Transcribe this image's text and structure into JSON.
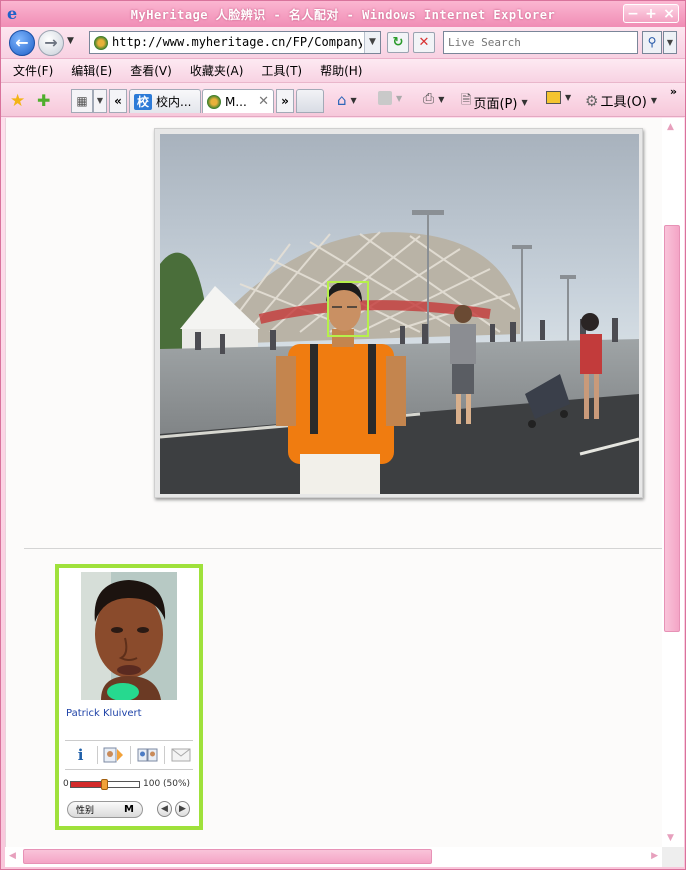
{
  "window": {
    "title": "MyHeritage 人脸辨识 - 名人配对 - Windows Internet Explorer",
    "controls": [
      "−",
      "+",
      "×"
    ]
  },
  "address": {
    "url": "http://www.myheritage.cn/FP/Company/face-r",
    "search_placeholder": "Live Search"
  },
  "menu": {
    "items": [
      "文件(F)",
      "编辑(E)",
      "查看(V)",
      "收藏夹(A)",
      "工具(T)",
      "帮助(H)"
    ]
  },
  "tabs": {
    "scroll_left": "«",
    "scroll_right": "»",
    "items": [
      {
        "label": "校内...",
        "active": false
      },
      {
        "label": "M...",
        "active": true
      }
    ]
  },
  "commands": {
    "page_label": "页面(P)",
    "tools_label": "工具(O)",
    "more": "»"
  },
  "match": {
    "name": "Patrick Kluivert",
    "score_min": "0",
    "score_max_label": "100 (50%)",
    "similarity": 0.5,
    "gender_label": "性别",
    "gender_value": "M"
  },
  "colors": {
    "chrome_pink": "#f7c8dc",
    "face_box": "#b6f04b",
    "card_border": "#9fe13b",
    "name_link": "#2044a8"
  }
}
